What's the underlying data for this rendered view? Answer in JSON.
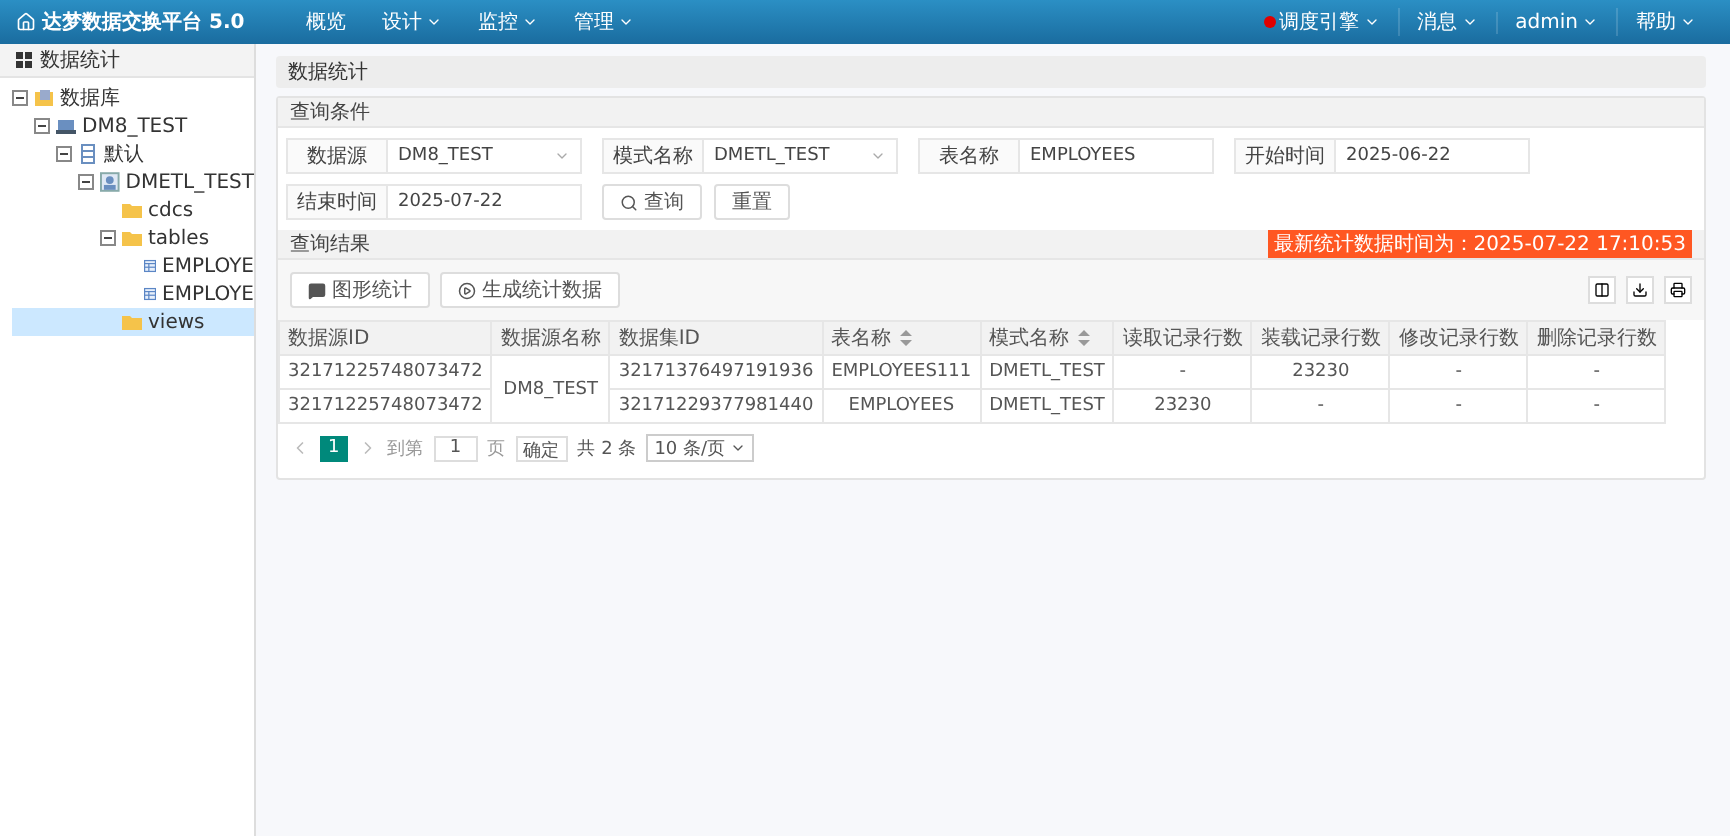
{
  "topbar": {
    "title": "达梦数据交换平台 5.0",
    "menu": [
      {
        "label": "概览",
        "dropdown": false
      },
      {
        "label": "设计",
        "dropdown": true
      },
      {
        "label": "监控",
        "dropdown": true
      },
      {
        "label": "管理",
        "dropdown": true
      }
    ],
    "right_menu": [
      {
        "label": "调度引擎",
        "dropdown": true,
        "indicator": true
      },
      {
        "label": "消息",
        "dropdown": true,
        "indicator": false
      },
      {
        "label": "admin",
        "dropdown": true,
        "indicator": false
      },
      {
        "label": "帮助",
        "dropdown": true,
        "indicator": false
      }
    ]
  },
  "sidebar": {
    "title": "数据统计",
    "tree": [
      {
        "label": "数据库",
        "kind": "database",
        "expanded": true,
        "selected": false,
        "children": [
          {
            "label": "DM8_TEST",
            "kind": "server",
            "expanded": true,
            "selected": false,
            "children": [
              {
                "label": "默认",
                "kind": "catalog",
                "expanded": true,
                "selected": false,
                "children": [
                  {
                    "label": "DMETL_TEST",
                    "kind": "schema",
                    "expanded": true,
                    "selected": false,
                    "children": [
                      {
                        "label": "cdcs",
                        "kind": "folder",
                        "selected": false
                      },
                      {
                        "label": "tables",
                        "kind": "folder",
                        "expanded": true,
                        "selected": false,
                        "children": [
                          {
                            "label": "EMPLOYE",
                            "kind": "table",
                            "selected": false
                          },
                          {
                            "label": "EMPLOYE",
                            "kind": "table",
                            "selected": false
                          }
                        ]
                      },
                      {
                        "label": "views",
                        "kind": "folder",
                        "selected": true
                      }
                    ]
                  }
                ]
              }
            ]
          }
        ]
      }
    ]
  },
  "main": {
    "title": "数据统计",
    "query": {
      "title": "查询条件",
      "fields": [
        {
          "label": "数据源",
          "value": "DM8_TEST",
          "kind": "select"
        },
        {
          "label": "模式名称",
          "value": "DMETL_TEST",
          "kind": "select"
        },
        {
          "label": "表名称",
          "value": "EMPLOYEES",
          "kind": "text"
        },
        {
          "label": "开始时间",
          "value": "2025-06-22",
          "kind": "text"
        },
        {
          "label": "结束时间",
          "value": "2025-07-22",
          "kind": "text"
        }
      ],
      "buttons": [
        {
          "label": "查询",
          "kind": "search"
        },
        {
          "label": "重置",
          "kind": "plain"
        }
      ]
    },
    "results": {
      "title": "查询结果",
      "notice": "最新统计数据时间为：2025-07-22 17:10:53",
      "toolbar": [
        {
          "label": "图形统计",
          "kind": "chart"
        },
        {
          "label": "生成统计数据",
          "kind": "play"
        }
      ],
      "table": {
        "columns": [
          {
            "label": "数据源ID",
            "sortable": false
          },
          {
            "label": "数据源名称",
            "sortable": false
          },
          {
            "label": "数据集ID",
            "sortable": false
          },
          {
            "label": "表名称",
            "sortable": true
          },
          {
            "label": "模式名称",
            "sortable": true
          },
          {
            "label": "读取记录行数",
            "sortable": false
          },
          {
            "label": "装载记录行数",
            "sortable": false
          },
          {
            "label": "修改记录行数",
            "sortable": false
          },
          {
            "label": "删除记录行数",
            "sortable": false
          }
        ],
        "rows": [
          [
            "32171225748073472",
            {
              "text": "DM8_TEST",
              "rowspan": 2
            },
            "32171376497191936",
            "EMPLOYEES111",
            "DMETL_TEST",
            "-",
            "23230",
            "-",
            "-"
          ],
          [
            "32171225748073472",
            "32171229377981440",
            "EMPLOYEES",
            "DMETL_TEST",
            "23230",
            "-",
            "-",
            "-"
          ]
        ]
      },
      "pagination": {
        "pages": [
          {
            "label": "1",
            "selected": true
          }
        ],
        "goto_label": "到第",
        "page_input": "1",
        "page_unit": "页",
        "confirm": "确定",
        "total": "共 2 条",
        "page_size": "10 条/页"
      }
    }
  }
}
